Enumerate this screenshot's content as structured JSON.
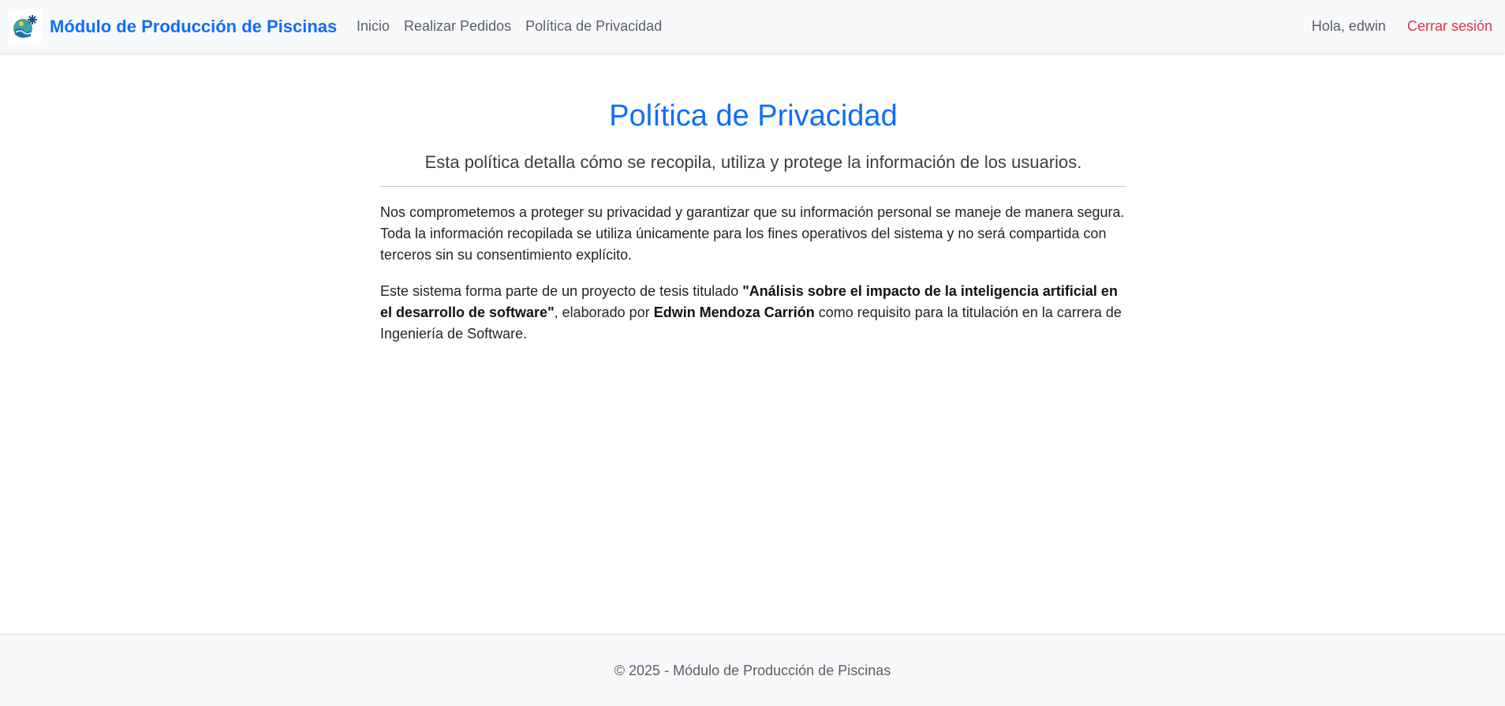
{
  "navbar": {
    "brand": "Módulo de Producción de Piscinas",
    "links": [
      "Inicio",
      "Realizar Pedidos",
      "Política de Privacidad"
    ],
    "greeting": "Hola, edwin",
    "logout": "Cerrar sesión",
    "icon": "pool-logo-icon"
  },
  "main": {
    "title": "Política de Privacidad",
    "lead": "Esta política detalla cómo se recopila, utiliza y protege la información de los usuarios.",
    "paragraph1": "Nos comprometemos a proteger su privacidad y garantizar que su información personal se maneje de manera segura. Toda la información recopilada se utiliza únicamente para los fines operativos del sistema y no será compartida con terceros sin su consentimiento explícito.",
    "paragraph2": {
      "intro": "Este sistema forma parte de un proyecto de tesis titulado ",
      "thesis_title": "\"Análisis sobre el impacto de la inteligencia artificial en el desarrollo de software\"",
      "middle": ", elaborado por ",
      "author": "Edwin Mendoza Carrión",
      "outro": " como requisito para la titulación en la carrera de Ingeniería de Software."
    }
  },
  "footer": {
    "text": "© 2025 - Módulo de Producción de Piscinas"
  },
  "colors": {
    "primary": "#0d6efd",
    "danger": "#dc3545",
    "navbar_bg": "#f8f9fa"
  }
}
